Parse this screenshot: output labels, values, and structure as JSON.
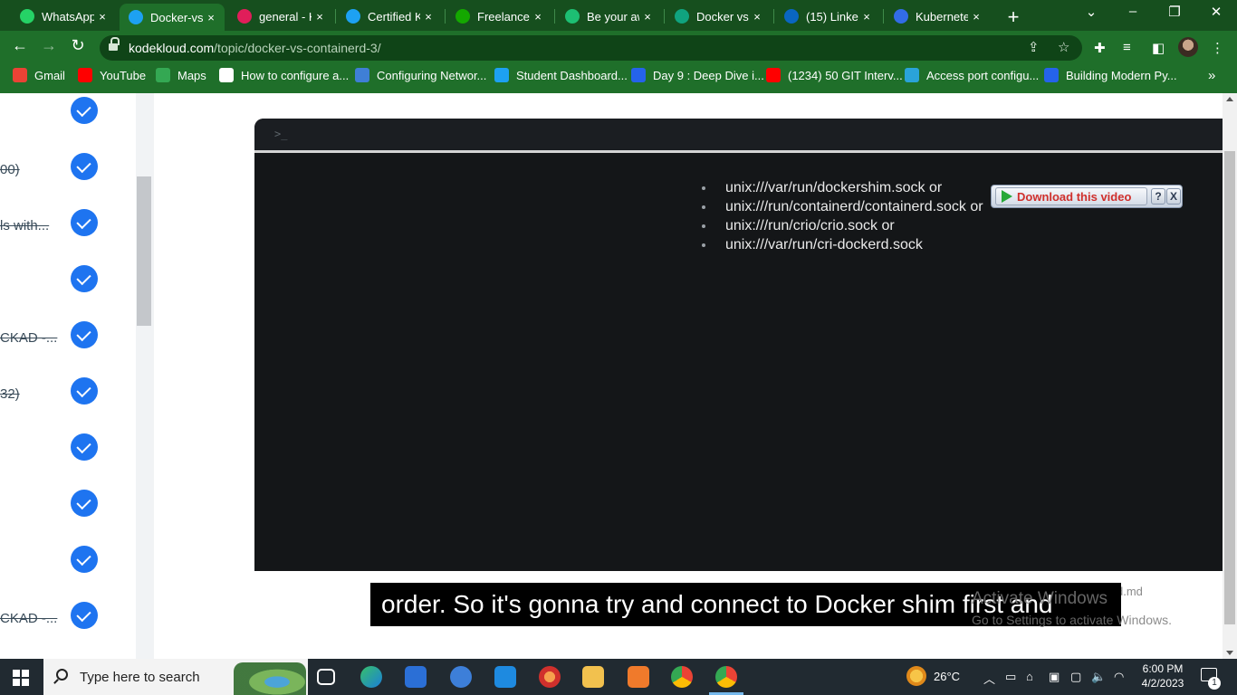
{
  "tabs": [
    {
      "label": "WhatsApp",
      "icon": "whatsapp-icon",
      "color": "#25d366"
    },
    {
      "label": "Docker-vs-",
      "icon": "kodekloud-icon",
      "color": "#1da1f2"
    },
    {
      "label": "general - K",
      "icon": "slack-icon",
      "color": "#e01e5a"
    },
    {
      "label": "Certified K",
      "icon": "kodekloud-icon",
      "color": "#1da1f2"
    },
    {
      "label": "Freelance I",
      "icon": "upwork-icon",
      "color": "#14a800"
    },
    {
      "label": "Be your aw",
      "icon": "fiverr-icon",
      "color": "#1dbf73"
    },
    {
      "label": "Docker vs",
      "icon": "openai-icon",
      "color": "#10a37f"
    },
    {
      "label": "(15) Linked",
      "icon": "linkedin-icon",
      "color": "#0a66c2"
    },
    {
      "label": "Kubernete",
      "icon": "kubernetes-icon",
      "color": "#326ce5"
    }
  ],
  "tab_close_glyph": "×",
  "new_tab_glyph": "+",
  "window": {
    "minimize": "–",
    "maximize": "❐",
    "close": "✕",
    "tab_search": "⌄"
  },
  "nav": {
    "back": "←",
    "forward": "→",
    "reload": "↻"
  },
  "address": {
    "host": "kodekloud.com",
    "path": "/topic/docker-vs-containerd-3/"
  },
  "bookmarks": [
    {
      "label": "Gmail",
      "color": "#ea4335"
    },
    {
      "label": "YouTube",
      "color": "#ff0000"
    },
    {
      "label": "Maps",
      "color": "#34a853"
    },
    {
      "label": "How to configure a...",
      "color": "#ffffff"
    },
    {
      "label": "Configuring Networ...",
      "color": "#3f7fd6"
    },
    {
      "label": "Student Dashboard...",
      "color": "#1da1f2"
    },
    {
      "label": "Day 9 : Deep Dive i...",
      "color": "#2563eb"
    },
    {
      "label": "(1234) 50 GIT Interv...",
      "color": "#ff0000"
    },
    {
      "label": "Access port configu...",
      "color": "#2aa3d9"
    },
    {
      "label": "Building Modern Py...",
      "color": "#2563eb"
    }
  ],
  "bookmarks_more": "»",
  "sidebar": {
    "lessons": [
      {
        "text": ""
      },
      {
        "text": "00)"
      },
      {
        "text": "ls with..."
      },
      {
        "text": ""
      },
      {
        "text": "CKAD -..."
      },
      {
        "text": "32)"
      },
      {
        "text": ""
      },
      {
        "text": ""
      },
      {
        "text": ""
      },
      {
        "text": "CKAD -..."
      }
    ]
  },
  "video": {
    "prompt": ">_",
    "socket_list": [
      "unix:///var/run/dockershim.sock or",
      "unix:///run/containerd/containerd.sock or",
      "unix:///run/crio/crio.sock or",
      "unix:///var/run/cri-dockerd.sock"
    ],
    "download_label": "Download this video",
    "download_help": "?",
    "download_close": "X",
    "caption": "order. So it's gonna try and connect to Docker shim first and",
    "file_fragment": "d.md"
  },
  "watermark": {
    "line1": "Activate Windows",
    "line2": "Go to Settings to activate Windows."
  },
  "taskbar": {
    "search_placeholder": "Type here to search",
    "weather": "26°C",
    "time": "6:00 PM",
    "date": "4/2/2023",
    "notifications": "1"
  }
}
